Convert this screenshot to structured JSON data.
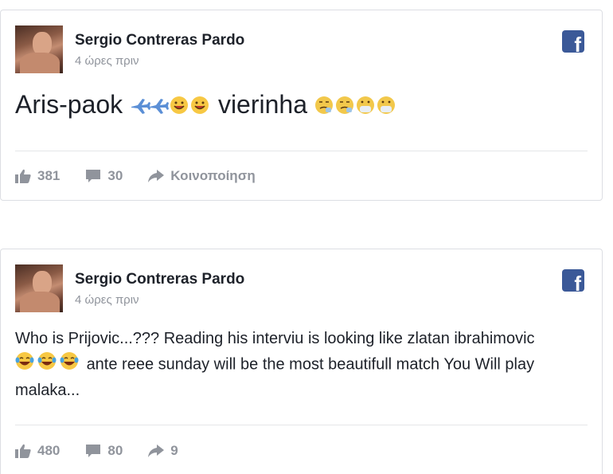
{
  "posts": [
    {
      "author": "Sergio Contreras Pardo",
      "time": "4 ώρες πριν",
      "text_before": "Aris-paok",
      "text_middle": "vierinha",
      "likes": "381",
      "comments": "30",
      "share_label": "Κοινοποίηση"
    },
    {
      "author": "Sergio Contreras Pardo",
      "time": "4 ώρες πριν",
      "line1": "Who is Prijovic...??? Reading his interviu is looking like zlatan ibrahimovic",
      "line2_after_emoji": "ante reee sunday will be the most beautifull match You Will play",
      "line3": "malaka...",
      "likes": "480",
      "comments": "80",
      "shares": "9"
    }
  ],
  "colors": {
    "facebook_blue": "#3b5998",
    "meta_gray": "#90949c",
    "text": "#1d2129"
  },
  "icons": [
    "facebook-icon",
    "like-icon",
    "comment-icon",
    "share-icon",
    "airplane-icon",
    "smile-icon",
    "sick-face-icon",
    "laughing-tears-icon"
  ]
}
